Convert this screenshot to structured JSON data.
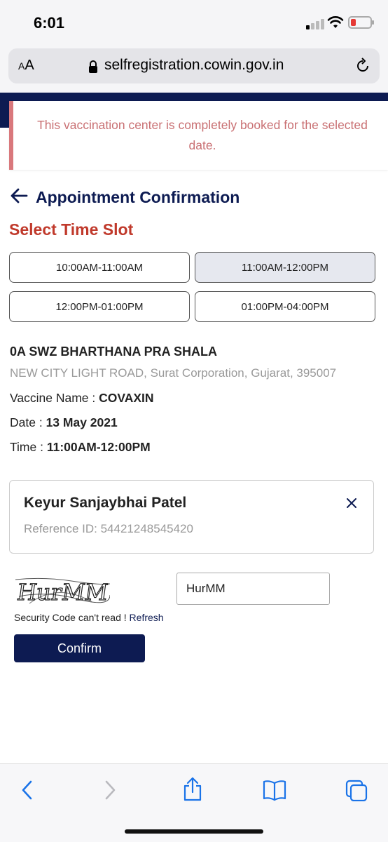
{
  "status_bar": {
    "time": "6:01"
  },
  "browser": {
    "aa_label_small": "A",
    "aa_label_large": "A",
    "url": "selfregistration.cowin.gov.in"
  },
  "alert": {
    "message": "This vaccination center is completely booked for the selected date."
  },
  "page": {
    "title": "Appointment Confirmation",
    "section_title": "Select Time Slot"
  },
  "slots": [
    {
      "label": "10:00AM-11:00AM",
      "selected": false
    },
    {
      "label": "11:00AM-12:00PM",
      "selected": true
    },
    {
      "label": "12:00PM-01:00PM",
      "selected": false
    },
    {
      "label": "01:00PM-04:00PM",
      "selected": false
    }
  ],
  "center": {
    "name": "0A SWZ BHARTHANA PRA SHALA",
    "address": "NEW CITY LIGHT ROAD, Surat Corporation, Gujarat, 395007",
    "vaccine_label": "Vaccine Name :",
    "vaccine_value": "COVAXIN",
    "date_label": "Date :",
    "date_value": "13 May 2021",
    "time_label": "Time :",
    "time_value": "11:00AM-12:00PM"
  },
  "beneficiary": {
    "name": "Keyur Sanjaybhai Patel",
    "reference": "Reference ID: 54421248545420"
  },
  "captcha": {
    "image_text": "HurMM",
    "input_value": "HurMM",
    "note": "Security Code can't read !",
    "refresh_label": "Refresh"
  },
  "actions": {
    "confirm_label": "Confirm"
  },
  "colors": {
    "navy": "#0d1b52",
    "alert_text": "#c97073",
    "alert_border": "#d9787c",
    "section_title": "#c0392b",
    "toolbar_icon": "#1a73e8"
  },
  "icons": [
    "lock-icon",
    "reload-icon",
    "back-arrow-icon",
    "close-icon",
    "back-icon",
    "forward-icon",
    "share-icon",
    "bookmarks-icon",
    "tabs-icon"
  ]
}
